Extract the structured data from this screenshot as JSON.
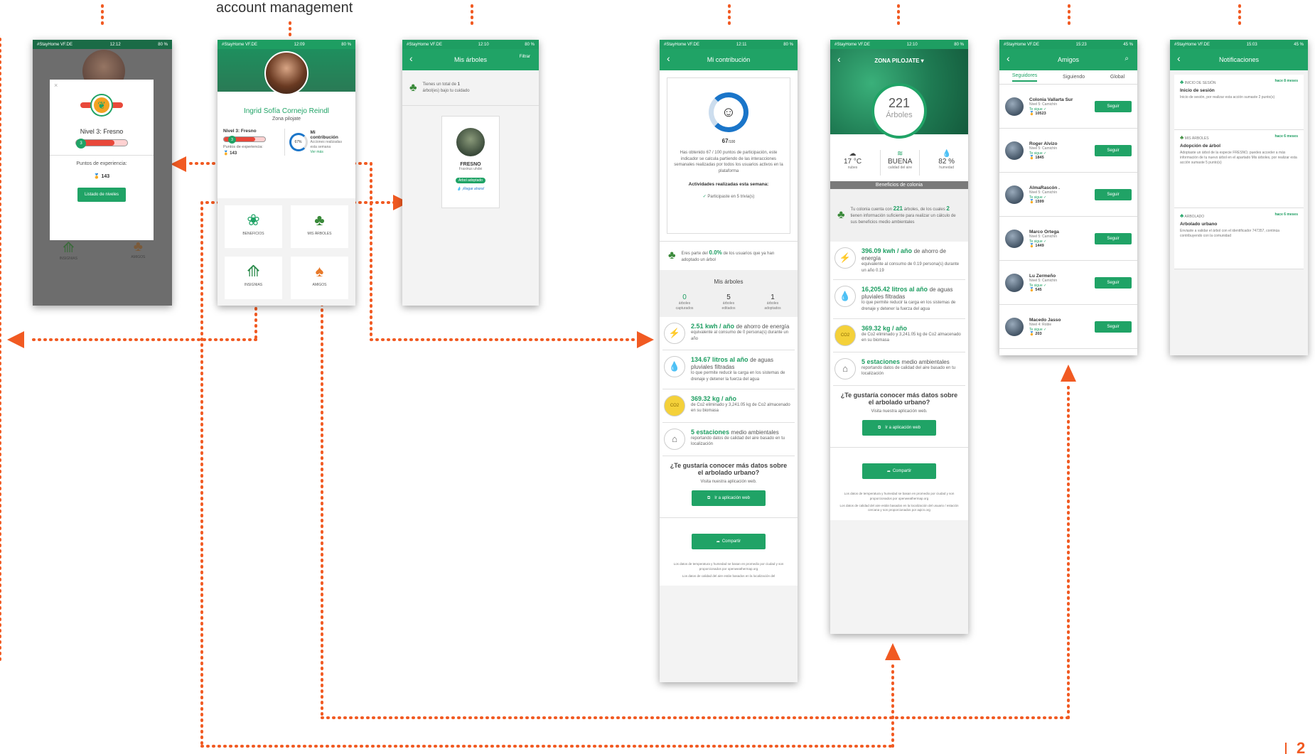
{
  "annotation": {
    "top_label": "account management",
    "page_num": "2"
  },
  "colors": {
    "brand": "#20a366",
    "connector": "#f15a22"
  },
  "status_bar": {
    "carrier": "#StayHome VF.DE",
    "times": [
      "12:12",
      "12:09",
      "12:10",
      "12:11",
      "12:10",
      "15:23",
      "15:03"
    ],
    "battery": [
      "80 %",
      "80 %",
      "80 %",
      "80 %",
      "80 %",
      "45 %",
      "45 %"
    ]
  },
  "level_modal": {
    "close": "×",
    "level": "Nivel 3: Fresno",
    "level_num": "3",
    "xp_label": "Puntos de experiencia:",
    "xp": "143",
    "button": "Listado de niveles",
    "bg_items": [
      "INSIGNIAS",
      "AMIGOS"
    ]
  },
  "profile": {
    "name": "Ingrid Sofía Cornejo Reindl",
    "zone": "Zona pilojate",
    "level": "Nivel 3: Fresno",
    "level_num": "3",
    "xp_label": "Puntos de experiencia:",
    "xp": "143",
    "contrib_title": "Mi contribución",
    "contrib_sub": "Acciones realizadas esta semana",
    "contrib_link": "Ver más",
    "contrib_pct": "67%",
    "tiles": [
      "BENEFICIOS",
      "MIS ÁRBOLES",
      "INSIGNIAS",
      "AMIGOS"
    ]
  },
  "mis_arboles": {
    "title": "Mis árboles",
    "right_icon": "Filtrar",
    "info_prefix": "Tienes un total de",
    "info_count": "1",
    "info_suffix": "árbol(es) bajo tu cuidado",
    "tree_name": "FRESNO",
    "tree_species": "Fraxinus uhdei",
    "tree_badge": "Árbol adoptado",
    "tree_action": "¡Regar ahora!"
  },
  "contribucion": {
    "title": "Mi contribución",
    "score": "67",
    "score_max": "/100",
    "desc": "Has obtenido 67 / 100 puntos de participación, este indicador se calcula partiendo de las interacciones semanales realizadas por todos los usuarios activos en la plataforma",
    "activities_title": "Actividades realizadas esta semana:",
    "activity": "Participaste en 5 trivia(s)",
    "adopt_pre": "Eres parte del",
    "adopt_pct": "0.0%",
    "adopt_post": "de los usuarios que ya han adoptado un árbol",
    "trees_title": "Mis árboles",
    "tree_stats": [
      {
        "n": "0",
        "l": "árboles capturados"
      },
      {
        "n": "5",
        "l": "árboles editados"
      },
      {
        "n": "1",
        "l": "árboles adoptados"
      }
    ],
    "benefits": [
      {
        "icon": "⚡",
        "title": "2.51 kwh / año",
        "title_rest": "de ahorro de energía",
        "desc": "equivalente al consumo de 0 persona(s) durante un año"
      },
      {
        "icon": "💧",
        "title": "134.67 litros al año",
        "title_rest": "de aguas pluviales filtradas",
        "desc": "lo que permite reducir la carga en los sistemas de drenaje y detener la fuerza del agua"
      },
      {
        "icon": "CO2",
        "title": "369.32 kg / año",
        "title_rest": "",
        "desc": "de Co2 eliminado y 3,241.05 kg de Co2 almacenado en su biomasa"
      },
      {
        "icon": "⌂",
        "title": "5 estaciones",
        "title_rest": "medio ambientales",
        "desc": "reportando datos de calidad del aire basado en tu localización"
      }
    ],
    "web_question": "¿Te gustaría conocer más datos sobre el arbolado urbano?",
    "web_sub": "Visita nuestra aplicación web.",
    "web_button": "Ir a aplicación web",
    "share_button": "Compartir",
    "footer1": "Los datos de temperatura y humedad se basan en promedio por ciudad y son proporcionados por openweathermap.org",
    "footer2": "Los datos de calidad del aire están basados en la localización del"
  },
  "zona": {
    "title": "ZONA PILOJATE",
    "count": "221",
    "count_label": "Árboles",
    "weather": [
      {
        "icon": "☁",
        "v": "17 °C",
        "l": "nubes"
      },
      {
        "icon": "≋",
        "v": "BUENA",
        "l": "calidad del aire"
      },
      {
        "icon": "💧",
        "v": "82 %",
        "l": "humedad"
      }
    ],
    "section": "Beneficios de colonia",
    "colonia_pre": "Tu colonia cuenta con",
    "colonia_count": "221",
    "colonia_mid": "árboles, de los cuales",
    "colonia_info": "2",
    "colonia_post": "tienen información suficiente para realizar un cálculo de sus beneficios medio ambientales",
    "benefits": [
      {
        "icon": "⚡",
        "title": "396.09 kwh / año",
        "title_rest": "de ahorro de energía",
        "desc": "equivalente al consumo de 0.19 persona(s) durante un año 0.19"
      },
      {
        "icon": "💧",
        "title": "16,205.42 litros al año",
        "title_rest": "de aguas pluviales filtradas",
        "desc": "lo que permite reducir la carga en los sistemas de drenaje y detener la fuerza del agua"
      },
      {
        "icon": "CO2",
        "title": "369.32 kg / año",
        "title_rest": "",
        "desc": "de Co2 eliminado y 3,241.05 kg de Co2 almacenado en su biomasa"
      },
      {
        "icon": "⌂",
        "title": "5 estaciones",
        "title_rest": "medio ambientales",
        "desc": "reportando datos de calidad del aire basado en tu localización"
      }
    ],
    "web_question": "¿Te gustaría conocer más datos sobre el arbolado urbano?",
    "web_sub": "Visita nuestra aplicación web.",
    "web_button": "Ir a aplicación web",
    "share_button": "Compartir",
    "footer1": "Los datos de temperatura y humedad se basan en promedio por ciudad y son proporcionados por openweathermap.org",
    "footer2": "Los datos de calidad del aire están basados en la localización del usuario / estación cercana y son proporcionados por aqicn.org"
  },
  "amigos": {
    "title": "Amigos",
    "tabs": [
      "Seguidores",
      "Siguiendo",
      "Global"
    ],
    "follow_btn": "Seguir",
    "follows_you": "Te sigue ✓",
    "users": [
      {
        "name": "Colonia Vallarta Sur",
        "level": "Nivel 5: Camichín",
        "xp": "10523"
      },
      {
        "name": "Roger Alvizo",
        "level": "Nivel 5: Camichín",
        "xp": "1845"
      },
      {
        "name": "AlmaRascón .",
        "level": "Nivel 5: Camichín",
        "xp": "1599"
      },
      {
        "name": "Marco Ortega",
        "level": "Nivel 5: Camichín",
        "xp": "1449"
      },
      {
        "name": "Lu Zermeño",
        "level": "Nivel 5: Camichín",
        "xp": "545"
      },
      {
        "name": "Macedo Jasso",
        "level": "Nivel 4: Roble",
        "xp": "203"
      }
    ]
  },
  "notificaciones": {
    "title": "Notificaciones",
    "items": [
      {
        "cat": "INICIO DE SESIÓN",
        "time": "hace 8 meses",
        "title": "Inicio de sesión",
        "desc": "Inicio de sesión, por realizar esta acción sumaste 2 punto(s)"
      },
      {
        "cat": "MIS ÁRBOLES",
        "time": "hace 6 meses",
        "title": "Adopción de árbol",
        "desc": "Adoptaste un árbol de la especie FRESNO, puedes acceder a más información de tu nuevo árbol en el apartado Mis árboles, por realizar esta acción sumaste 5 punto(s)"
      },
      {
        "cat": "ARBOLADO",
        "time": "hace 6 meses",
        "title": "Arbolado urbano",
        "desc": "Enviaste a validar el árbol con el identificador 747357, continúa contribuyendo con la comunidad"
      }
    ]
  }
}
